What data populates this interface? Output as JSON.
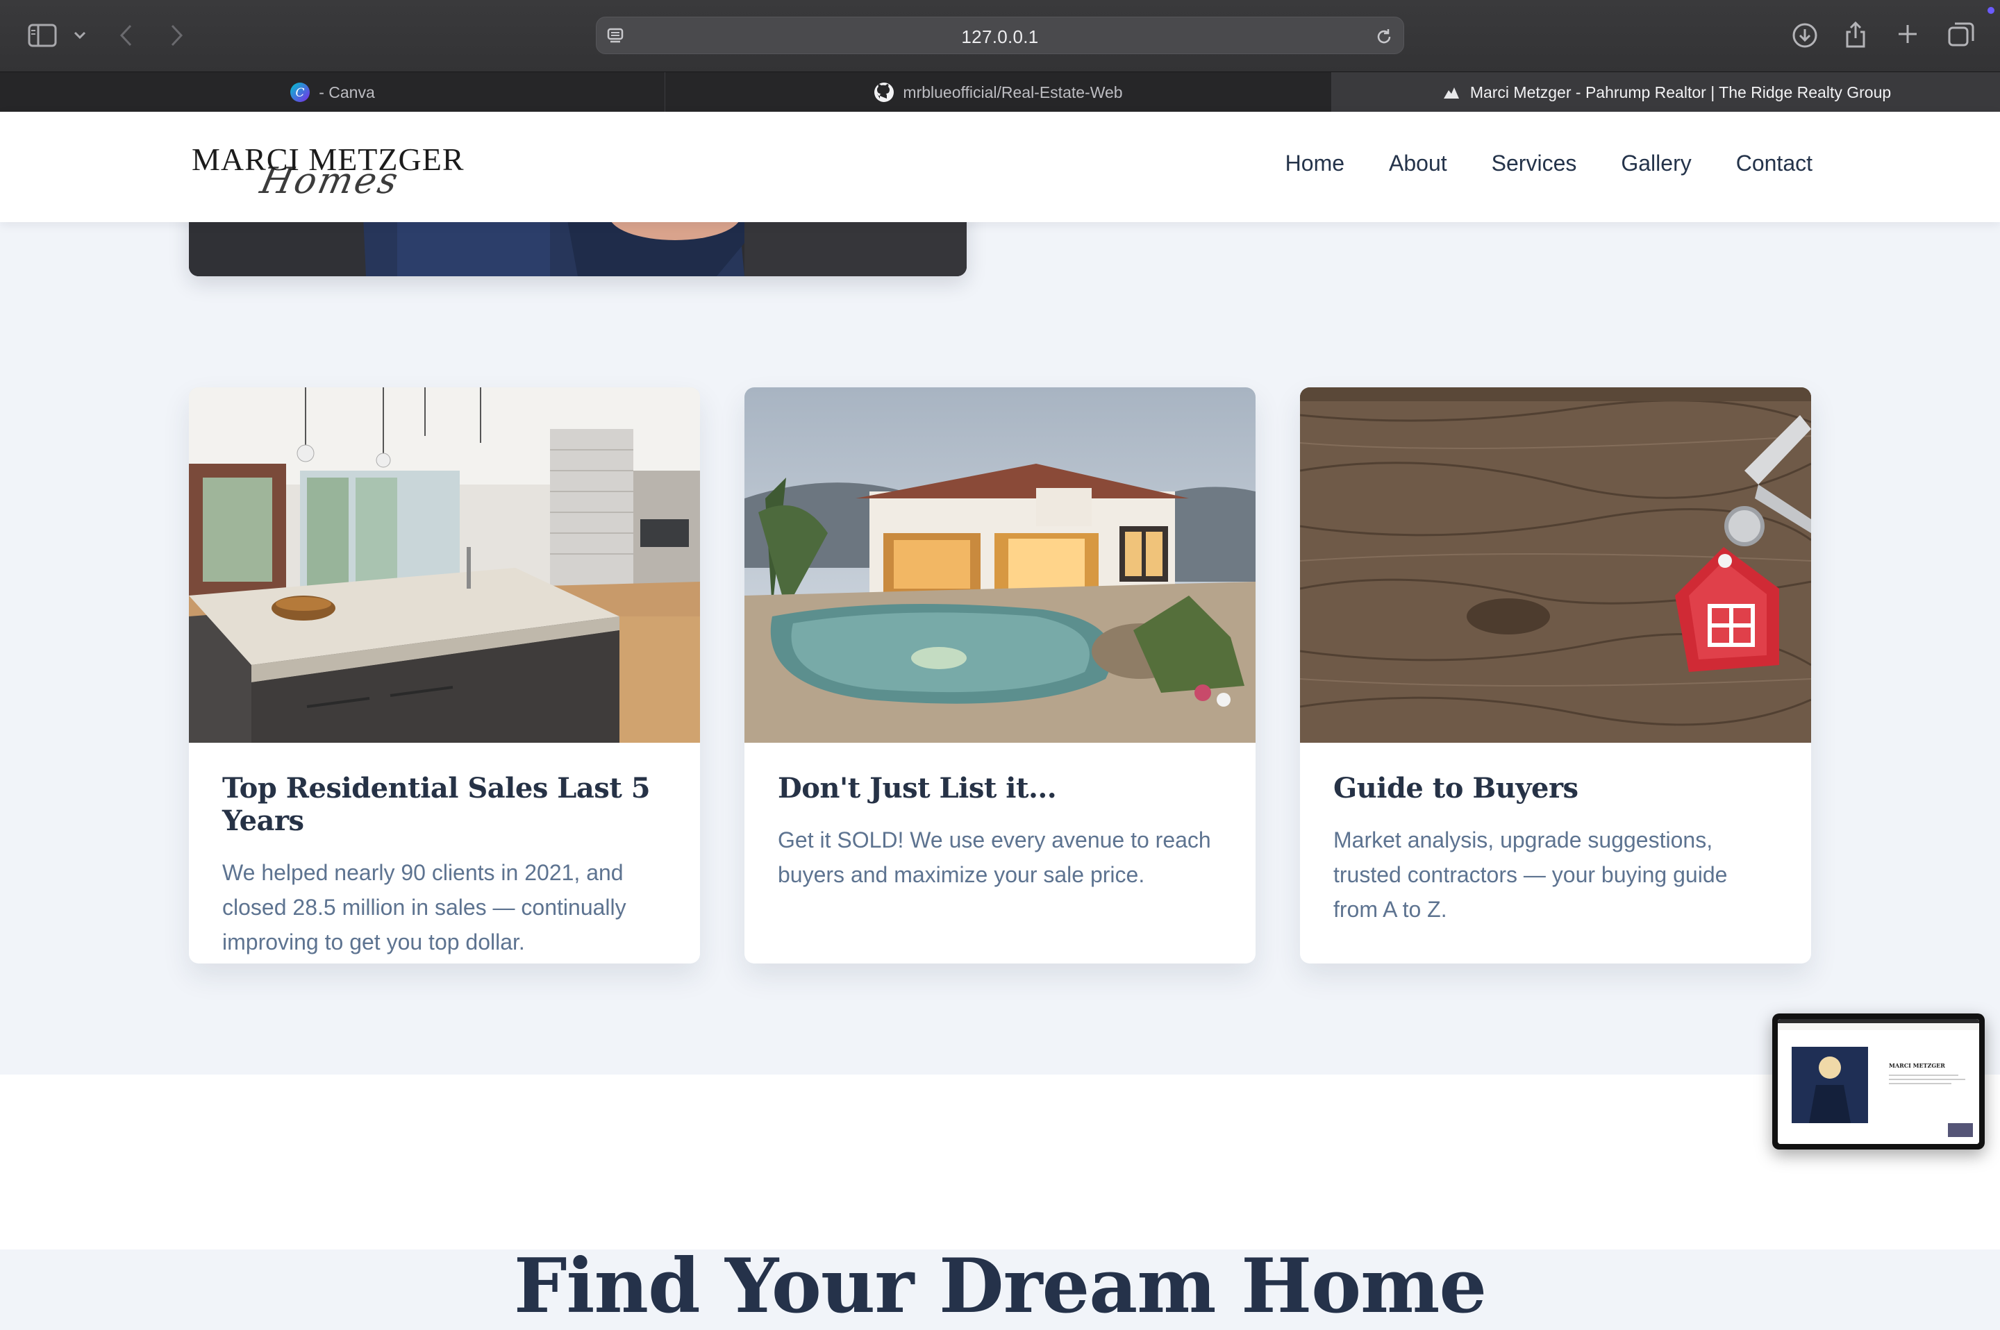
{
  "browser": {
    "url": "127.0.0.1",
    "tabs": [
      {
        "label": "- Canva",
        "icon": "canva-icon",
        "active": false
      },
      {
        "label": "mrblueofficial/Real-Estate-Web",
        "icon": "github-icon",
        "active": false
      },
      {
        "label": "Marci Metzger - Pahrump Realtor | The Ridge Realty Group",
        "icon": "site-favicon-icon",
        "active": true
      }
    ]
  },
  "site": {
    "logo": {
      "main": "MARCI METZGER",
      "script": "Homes"
    },
    "nav": [
      "Home",
      "About",
      "Services",
      "Gallery",
      "Contact"
    ]
  },
  "cards": [
    {
      "title": "Top Residential Sales Last 5 Years",
      "text": "We helped nearly 90 clients in 2021, and closed 28.5 million in sales — continually improving to get you top dollar.",
      "image": "kitchen-photo"
    },
    {
      "title": "Don't Just List it...",
      "text": "Get it SOLD! We use every avenue to reach buyers and maximize your sale price.",
      "image": "pool-house-photo"
    },
    {
      "title": "Guide to Buyers",
      "text": "Market analysis, upgrade suggestions, trusted contractors — your buying guide from A to Z.",
      "image": "house-key-photo"
    }
  ],
  "section_title": "Find Your Dream Home",
  "pip_preview": {
    "heading": "MARCI METZGER"
  }
}
